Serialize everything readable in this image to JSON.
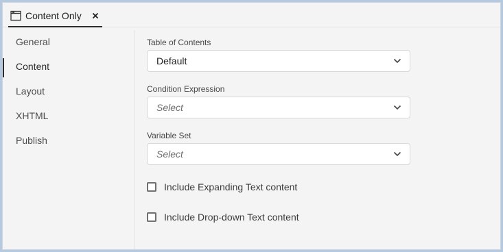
{
  "tab": {
    "title": "Content Only",
    "icon": "window-icon",
    "close_icon": "close-icon"
  },
  "sidebar": {
    "items": [
      {
        "label": "General",
        "active": false
      },
      {
        "label": "Content",
        "active": true
      },
      {
        "label": "Layout",
        "active": false
      },
      {
        "label": "XHTML",
        "active": false
      },
      {
        "label": "Publish",
        "active": false
      }
    ]
  },
  "form": {
    "toc": {
      "label": "Table of Contents",
      "value": "Default"
    },
    "condition": {
      "label": "Condition Expression",
      "placeholder": "Select"
    },
    "variable_set": {
      "label": "Variable Set",
      "placeholder": "Select"
    },
    "checkboxes": [
      {
        "label": "Include Expanding Text content",
        "checked": false
      },
      {
        "label": "Include Drop-down Text content",
        "checked": false
      }
    ]
  }
}
